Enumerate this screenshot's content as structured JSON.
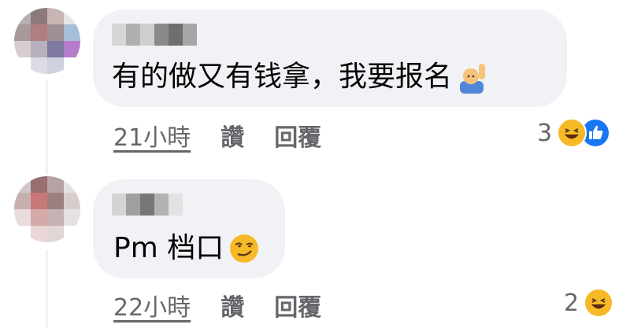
{
  "comments": [
    {
      "text": "有的做又有钱拿，我要报名",
      "timestamp": "21小時",
      "like_label": "讚",
      "reply_label": "回覆",
      "reaction_count": "3",
      "trailing_emoji": "person-raising-hand-emoji",
      "reactions": [
        "haha-icon",
        "like-icon"
      ]
    },
    {
      "text": "Pm 档口",
      "timestamp": "22小時",
      "like_label": "讚",
      "reply_label": "回覆",
      "reaction_count": "2",
      "trailing_emoji": "smirking-face-emoji",
      "reactions": [
        "haha-icon"
      ]
    }
  ],
  "colors": {
    "bubble": "#f0f2f5",
    "text": "#050505",
    "meta": "#65676b",
    "like_blue": "#1877f2",
    "emoji_yellow": "#f7b928"
  }
}
